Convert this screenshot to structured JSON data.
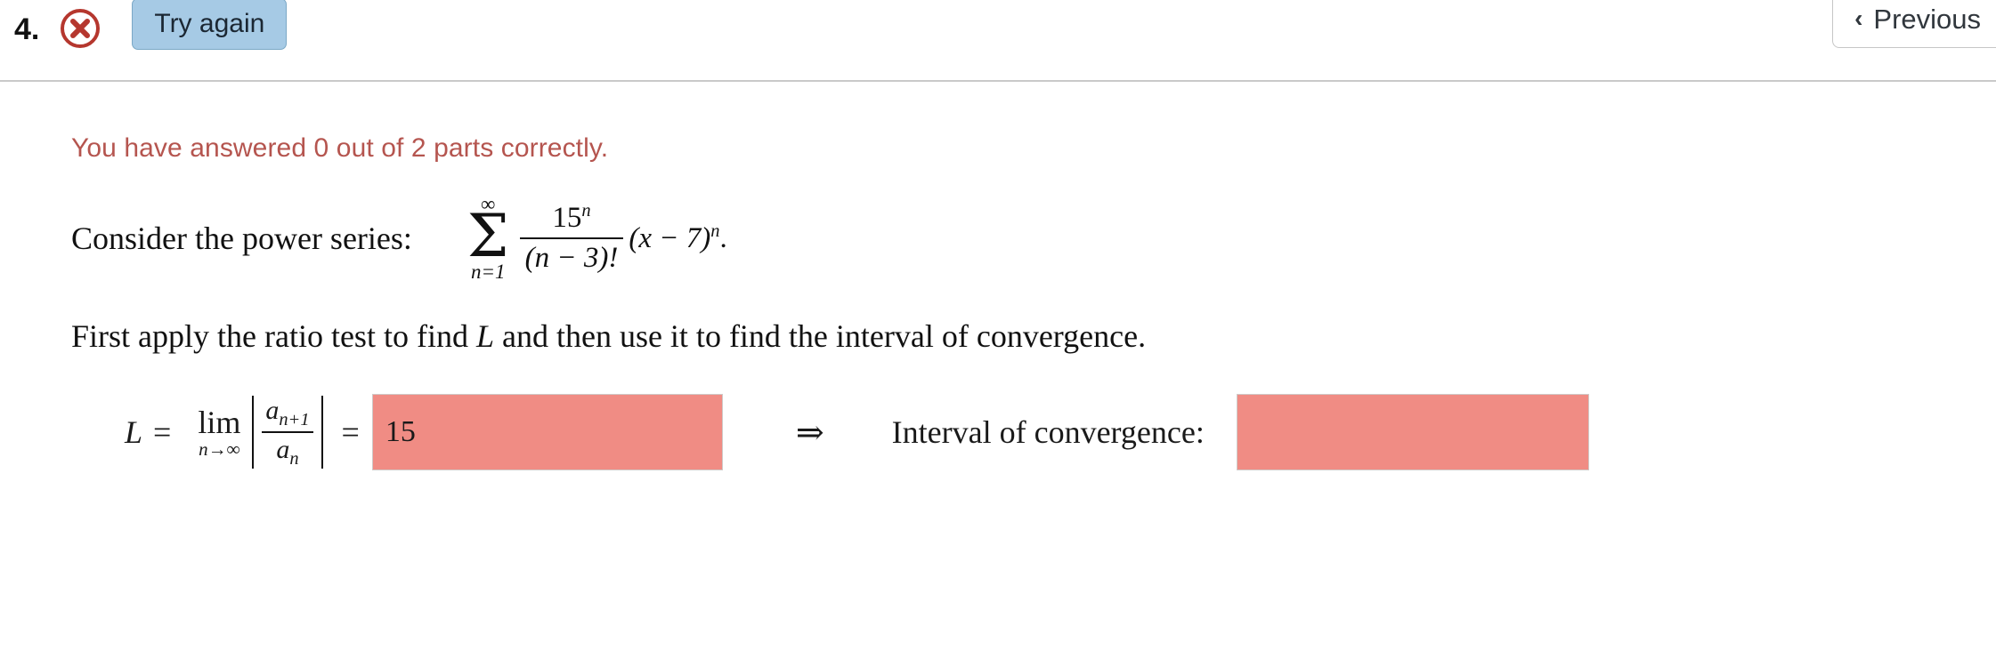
{
  "header": {
    "question_number": "4.",
    "status_icon": "x-circle-icon",
    "status_icon_color": "#b5372e",
    "try_again_label": "Try again",
    "try_again_bg": "#a6cae5",
    "previous_label": "Previous",
    "previous_chevron": "‹"
  },
  "feedback": {
    "text": "You have answered 0 out of 2 parts correctly.",
    "color": "#b5554f"
  },
  "problem": {
    "prompt": "Consider the power series:",
    "series": {
      "sigma": "Σ",
      "upper_limit": "∞",
      "lower_limit": "n=1",
      "numerator": "15",
      "numerator_exponent": "n",
      "denominator": "(n − 3)!",
      "tail": "(x − 7)",
      "tail_exponent": "n",
      "period": "."
    },
    "instruction_part1": "First apply the ratio test to find ",
    "instruction_variable": "L",
    "instruction_part2": " and then use it to find the interval of convergence."
  },
  "answer_row": {
    "L_symbol": "L",
    "equals": "=",
    "lim_word": "lim",
    "lim_subscript": "n→∞",
    "ratio_numerator": "a",
    "ratio_numerator_sub": "n+1",
    "ratio_denominator": "a",
    "ratio_denominator_sub": "n",
    "equals2": "=",
    "L_value": "15",
    "L_value_placeholder": "",
    "implies_symbol": "⇒",
    "interval_label": "Interval of convergence:",
    "interval_value": "",
    "interval_placeholder": "",
    "incorrect_field_bg": "#f08c84"
  }
}
